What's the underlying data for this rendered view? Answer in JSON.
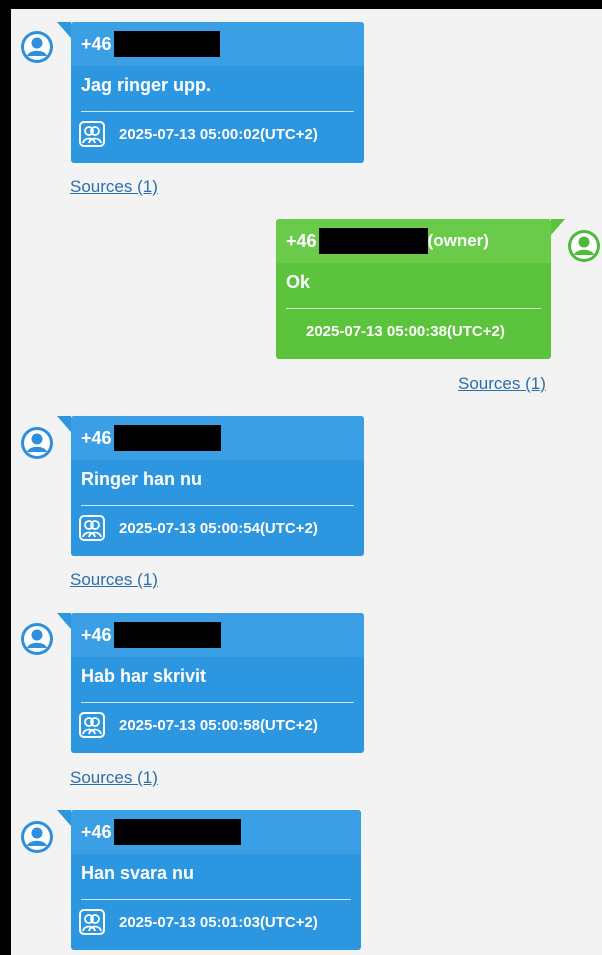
{
  "colors": {
    "incoming_bubble": "#2d96e0",
    "outgoing_bubble": "#5cc43c",
    "link": "#2a6fb0",
    "background": "#f3f3f3"
  },
  "messages": [
    {
      "direction": "incoming",
      "sender": "+46",
      "sender_suffix": "",
      "text": "Jag ringer upp.",
      "timestamp": "2025-07-13 05:00:02(UTC+2)",
      "sources_label": "Sources (1)",
      "avatar_icon": "user-avatar-icon"
    },
    {
      "direction": "outgoing",
      "sender": "+46",
      "sender_suffix": "(owner)",
      "text": "Ok",
      "timestamp": "2025-07-13 05:00:38(UTC+2)",
      "sources_label": "Sources (1)",
      "avatar_icon": "user-avatar-icon"
    },
    {
      "direction": "incoming",
      "sender": "+46",
      "sender_suffix": "",
      "text": "Ringer han nu",
      "timestamp": "2025-07-13 05:00:54(UTC+2)",
      "sources_label": "Sources (1)",
      "avatar_icon": "user-avatar-icon"
    },
    {
      "direction": "incoming",
      "sender": "+46",
      "sender_suffix": "",
      "text": "Hab har skrivit",
      "timestamp": "2025-07-13 05:00:58(UTC+2)",
      "sources_label": "Sources (1)",
      "avatar_icon": "user-avatar-icon"
    },
    {
      "direction": "incoming",
      "sender": "+46",
      "sender_suffix": "",
      "text": "Han svara nu",
      "timestamp": "2025-07-13 05:01:03(UTC+2)",
      "sources_label": "",
      "avatar_icon": "user-avatar-icon"
    }
  ]
}
